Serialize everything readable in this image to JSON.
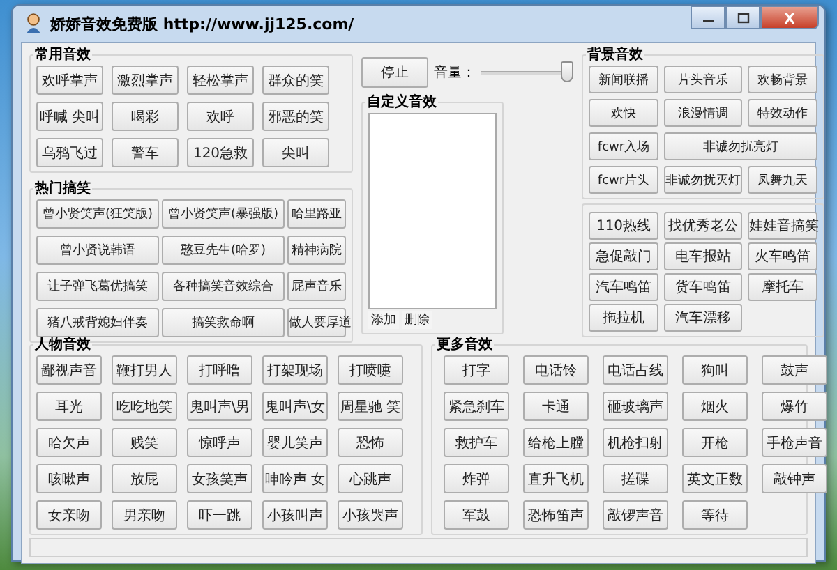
{
  "window": {
    "title": "娇娇音效免费版 http://www.jj125.com/"
  },
  "common": {
    "title": "常用音效",
    "buttons": [
      "欢呼掌声",
      "激烈掌声",
      "轻松掌声",
      "群众的笑",
      "呼喊 尖叫",
      "喝彩",
      "欢呼",
      "邪恶的笑",
      "乌鸦飞过",
      "警车",
      "120急救",
      "尖叫"
    ]
  },
  "hot": {
    "title": "热门搞笑",
    "buttons": [
      "曾小贤笑声(狂笑版)",
      "曾小贤笑声(暴强版)",
      "哈里路亚",
      "曾小贤说韩语",
      "憨豆先生(哈罗)",
      "精神病院",
      "让子弹飞葛优搞笑",
      "各种搞笑音效综合",
      "屁声音乐",
      "猪八戒背媳妇伴奏",
      "搞笑救命啊",
      "做人要厚道"
    ]
  },
  "player": {
    "stop": "停止",
    "volume_label": "音量：",
    "volume": {
      "level": 1
    }
  },
  "custom": {
    "title": "自定义音效",
    "buttons": [
      "添加",
      "删除"
    ]
  },
  "background": {
    "title": "背景音效",
    "buttons": [
      {
        "label": "新闻联播",
        "kind": "normal"
      },
      {
        "label": "片头音乐",
        "kind": "normal"
      },
      {
        "label": "欢畅背景",
        "kind": "normal"
      },
      {
        "label": "欢快",
        "kind": "normal"
      },
      {
        "label": "浪漫情调",
        "kind": "normal"
      },
      {
        "label": "特效动作",
        "kind": "normal"
      },
      {
        "label": "fcwr入场",
        "kind": "normal"
      },
      {
        "label": "非诚勿扰亮灯",
        "kind": "wide"
      },
      {
        "label": "fcwr片头",
        "kind": "normal"
      },
      {
        "label": "非诚勿扰灭灯",
        "kind": "normal"
      },
      {
        "label": "凤舞九天",
        "kind": "normal"
      }
    ]
  },
  "vehicles": {
    "buttons": [
      "110热线",
      "找优秀老公",
      "娃娃音搞笑",
      "急促敲门",
      "电车报站",
      "火车鸣笛",
      "汽车鸣笛",
      "货车鸣笛",
      "摩托车",
      "拖拉机",
      "汽车漂移"
    ]
  },
  "people": {
    "title": "人物音效",
    "buttons": [
      "鄙视声音",
      "鞭打男人",
      "打呼噜",
      "打架现场",
      "打喷嚏",
      "耳光",
      "吃吃地笑",
      "鬼叫声\\男",
      "鬼叫声\\女",
      "周星驰 笑",
      "哈欠声",
      "贱笑",
      "惊呼声",
      "婴儿笑声",
      "恐怖",
      "咳嗽声",
      "放屁",
      "女孩笑声",
      "呻吟声 女",
      "心跳声",
      "女亲吻",
      "男亲吻",
      "吓一跳",
      "小孩叫声",
      "小孩哭声"
    ]
  },
  "more": {
    "title": "更多音效",
    "buttons": [
      "打字",
      "电话铃",
      "电话占线",
      "狗叫",
      "鼓声",
      "紧急刹车",
      "卡通",
      "砸玻璃声",
      "烟火",
      "爆竹",
      "救护车",
      "给枪上膛",
      "机枪扫射",
      "开枪",
      "手枪声音",
      "炸弹",
      "直升飞机",
      "搓碟",
      "英文正数",
      "敲钟声",
      "军鼓",
      "恐怖笛声",
      "敲锣声音",
      "等待"
    ]
  }
}
